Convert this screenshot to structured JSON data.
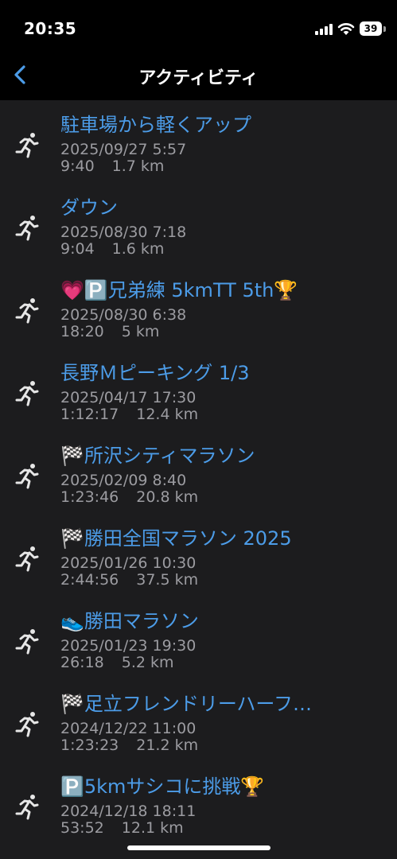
{
  "status_bar": {
    "time": "20:35",
    "battery_level": "39"
  },
  "header": {
    "title": "アクティビティ"
  },
  "activities": [
    {
      "title": "駐車場から軽くアップ",
      "date": "2025/09/27 5:57",
      "duration": "9:40",
      "distance": "1.7 km"
    },
    {
      "title": "ダウン",
      "date": "2025/08/30 7:18",
      "duration": "9:04",
      "distance": "1.6 km"
    },
    {
      "title": "💗🅿️兄弟練 5kmTT 5th🏆",
      "date": "2025/08/30 6:38",
      "duration": "18:20",
      "distance": "5 km"
    },
    {
      "title": "長野Ｍピーキング 1/3",
      "date": "2025/04/17 17:30",
      "duration": "1:12:17",
      "distance": "12.4 km"
    },
    {
      "title": "🏁所沢シティマラソン",
      "date": "2025/02/09 8:40",
      "duration": "1:23:46",
      "distance": "20.8 km"
    },
    {
      "title": "🏁勝田全国マラソン 2025",
      "date": "2025/01/26 10:30",
      "duration": "2:44:56",
      "distance": "37.5 km"
    },
    {
      "title": "👟勝田マラソン",
      "date": "2025/01/23 19:30",
      "duration": "26:18",
      "distance": "5.2 km"
    },
    {
      "title": "🏁足立フレンドリーハーフ…",
      "date": "2024/12/22 11:00",
      "duration": "1:23:23",
      "distance": "21.2 km"
    },
    {
      "title": "🅿️5kmサシコに挑戦🏆",
      "date": "2024/12/18 18:11",
      "duration": "53:52",
      "distance": "12.1 km"
    }
  ],
  "icons": {
    "row_icon": "running-icon",
    "back": "chevron-left-icon"
  },
  "colors": {
    "accent": "#4c9ce8",
    "secondary_text": "#9c9ca1",
    "list_background": "#1c1c1e"
  }
}
